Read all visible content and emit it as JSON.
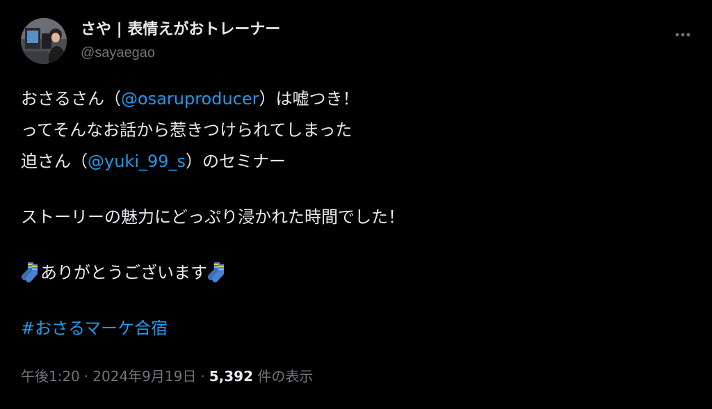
{
  "user": {
    "display_name": "さや | 表情えがおトレーナー",
    "handle": "@sayaegao"
  },
  "tweet": {
    "line1_pre": "おさるさん（",
    "line1_mention": "@osaruproducer",
    "line1_post": "）は嘘つき！",
    "line2": "ってそんなお話から惹きつけられてしまった",
    "line3_pre": "迫さん（",
    "line3_mention": "@yuki_99_s",
    "line3_post": "）のセミナー",
    "line4": "ストーリーの魅力にどっぷり浸かれた時間でした！",
    "line5_text": "ありがとうございます",
    "hashtag": "#おさるマーケ合宿"
  },
  "meta": {
    "time": "午後1:20",
    "separator": "·",
    "date": "2024年9月19日",
    "views_count": "5,392",
    "views_label": "件の表示"
  },
  "icons": {
    "more": "more-horizontal-icon",
    "emoji": "socks-emoji"
  },
  "colors": {
    "background": "#000000",
    "text": "#e7e9ea",
    "secondary": "#71767b",
    "link": "#1d9bf0"
  }
}
